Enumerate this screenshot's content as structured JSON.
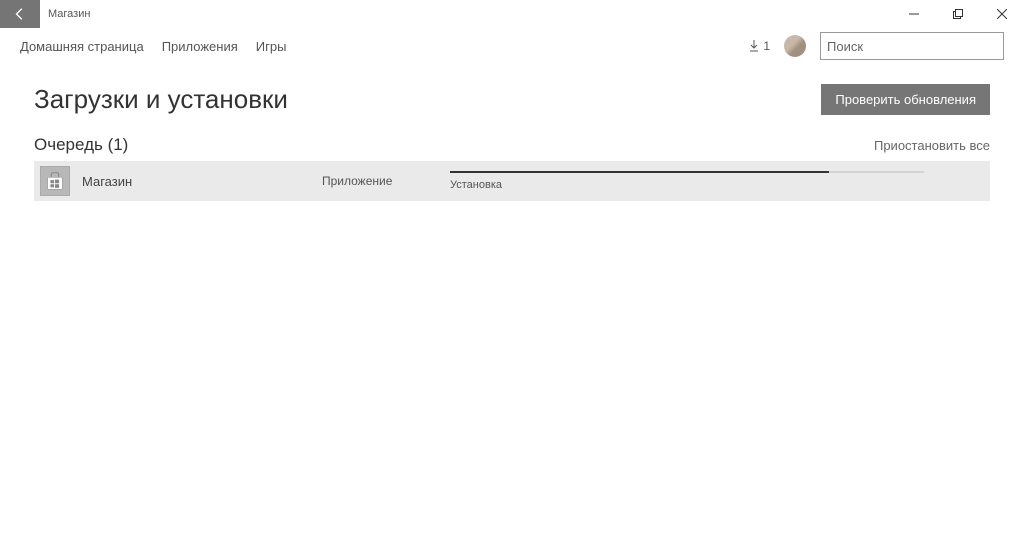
{
  "window": {
    "title": "Магазин"
  },
  "nav": {
    "items": [
      "Домашняя страница",
      "Приложения",
      "Игры"
    ],
    "download_count": "1",
    "search_placeholder": "Поиск"
  },
  "page": {
    "title": "Загрузки и установки",
    "update_btn": "Проверить обновления",
    "queue_title": "Очередь (1)",
    "pause_all": "Приостановить все"
  },
  "queue": [
    {
      "name": "Магазин",
      "type": "Приложение",
      "status": "Установка",
      "progress_pct": 80
    }
  ]
}
